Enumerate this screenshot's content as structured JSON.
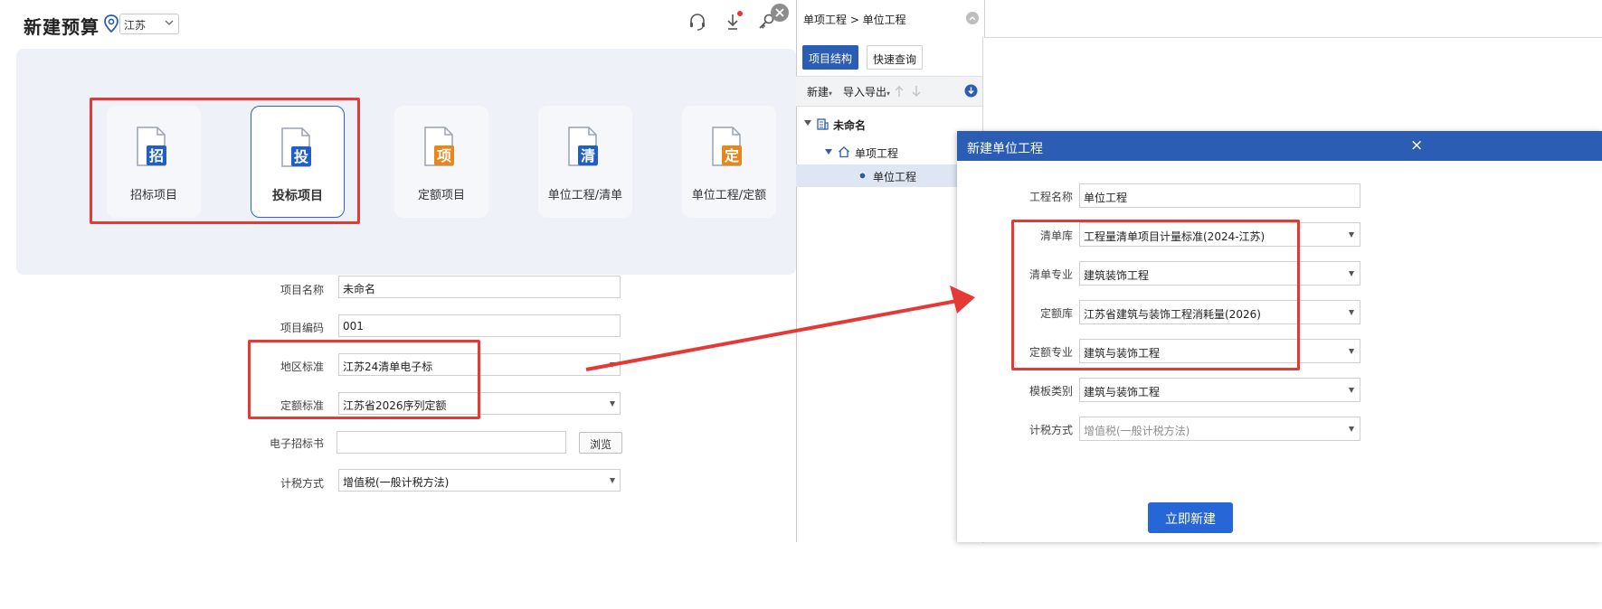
{
  "left": {
    "title": "新建预算",
    "region": "江苏",
    "cards": [
      {
        "label": "招标项目",
        "glyph": "招",
        "color": "#1f5fc7",
        "active": false
      },
      {
        "label": "投标项目",
        "glyph": "投",
        "color": "#1f5fc7",
        "active": true
      },
      {
        "label": "定额项目",
        "glyph": "项",
        "color": "#e8861a",
        "active": false
      },
      {
        "label": "单位工程/清单",
        "glyph": "清",
        "color": "#1f5fc7",
        "active": false
      },
      {
        "label": "单位工程/定额",
        "glyph": "定",
        "color": "#e8861a",
        "active": false
      }
    ],
    "form": {
      "name_label": "项目名称",
      "name_value": "未命名",
      "code_label": "项目编码",
      "code_value": "001",
      "region_std_label": "地区标准",
      "region_std_value": "江苏24清单电子标",
      "quota_std_label": "定额标准",
      "quota_std_value": "江苏省2026序列定额",
      "bid_label": "电子招标书",
      "bid_value": "",
      "browse_label": "浏览",
      "tax_label": "计税方式",
      "tax_value": "增值税(一般计税方法)"
    }
  },
  "right": {
    "breadcrumb": "单项工程 > 单位工程",
    "tabs": [
      "项目结构",
      "快速查询"
    ],
    "toolbar": {
      "new": "新建",
      "import_export": "导入导出"
    },
    "tree": {
      "root": "未命名",
      "child": "单项工程",
      "leaf": "单位工程"
    }
  },
  "dialog": {
    "title": "新建单位工程",
    "close": "×",
    "fields": [
      {
        "label": "工程名称",
        "value": "单位工程",
        "select": false,
        "disabled": false
      },
      {
        "label": "清单库",
        "value": "工程量清单项目计量标准(2024-江苏)",
        "select": true,
        "disabled": false
      },
      {
        "label": "清单专业",
        "value": "建筑装饰工程",
        "select": true,
        "disabled": false
      },
      {
        "label": "定额库",
        "value": "江苏省建筑与装饰工程消耗量(2026)",
        "select": true,
        "disabled": false
      },
      {
        "label": "定额专业",
        "value": "建筑与装饰工程",
        "select": true,
        "disabled": false
      },
      {
        "label": "模板类别",
        "value": "建筑与装饰工程",
        "select": true,
        "disabled": false
      },
      {
        "label": "计税方式",
        "value": "增值税(一般计税方法)",
        "select": true,
        "disabled": true
      }
    ],
    "submit": "立即新建"
  },
  "colors": {
    "primary": "#2b5db5",
    "button": "#2766d6",
    "highlight": "#e53935"
  }
}
